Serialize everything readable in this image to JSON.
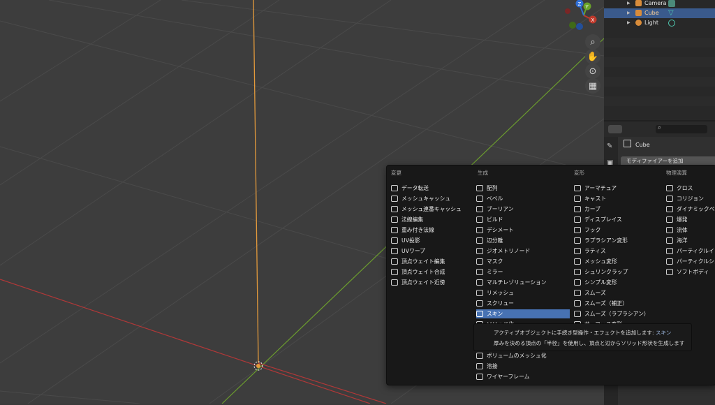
{
  "outliner": {
    "items": [
      {
        "label": "Camera",
        "icon": "camera-icon",
        "data_icon": "camera-data-icon"
      },
      {
        "label": "Cube",
        "icon": "mesh-icon",
        "data_icon": "mesh-data-icon"
      },
      {
        "label": "Light",
        "icon": "light-icon",
        "data_icon": "light-data-icon"
      }
    ]
  },
  "properties": {
    "object_name": "Cube",
    "add_modifier_label": "モディファイアーを追加"
  },
  "menu": {
    "columns": [
      {
        "header": "変更",
        "items": [
          "データ転送",
          "メッシュキャッシュ",
          "メッシュ連番キャッシュ",
          "法線編集",
          "重み付き法線",
          "UV投影",
          "UVワープ",
          "頂点ウェイト編集",
          "頂点ウェイト合成",
          "頂点ウェイト近傍"
        ]
      },
      {
        "header": "生成",
        "items": [
          "配列",
          "ベベル",
          "ブーリアン",
          "ビルド",
          "デシメート",
          "辺分離",
          "ジオメトリノード",
          "マスク",
          "ミラー",
          "マルチレゾリューション",
          "リメッシュ",
          "スクリュー",
          "スキン",
          "ソリッド化",
          "",
          "",
          "ボリュームのメッシュ化",
          "溶接",
          "ワイヤーフレーム"
        ]
      },
      {
        "header": "変形",
        "items": [
          "アーマチュア",
          "キャスト",
          "カーブ",
          "ディスプレイス",
          "フック",
          "ラプラシアン変形",
          "ラティス",
          "メッシュ変形",
          "シュリンクラップ",
          "シンプル変形",
          "スムーズ",
          "スムーズ（補正）",
          "スムーズ（ラプラシアン）",
          "サーフェス変形"
        ]
      },
      {
        "header": "物理演算",
        "items": [
          "クロス",
          "コリジョン",
          "ダイナミックペイント",
          "爆発",
          "流体",
          "海洋",
          "パーティクルインスタンス",
          "パーティクルシステム",
          "ソフトボディ"
        ]
      }
    ],
    "highlighted": "スキン"
  },
  "tooltip": {
    "title": "アクティブオブジェクトに手続き型操作・エフェクトを追加します:",
    "title_sub": "スキン",
    "description": "厚みを決める頂点の「半径」を使用し、頂点と辺からソリッド形状を生成します"
  },
  "gizmo": {
    "x": "X",
    "y": "Y",
    "z": "Z"
  },
  "colors": {
    "selection": "#4772b3",
    "x_axis": "#c0392b",
    "y_axis": "#6aa42a",
    "z_axis": "#2f6fd6"
  }
}
